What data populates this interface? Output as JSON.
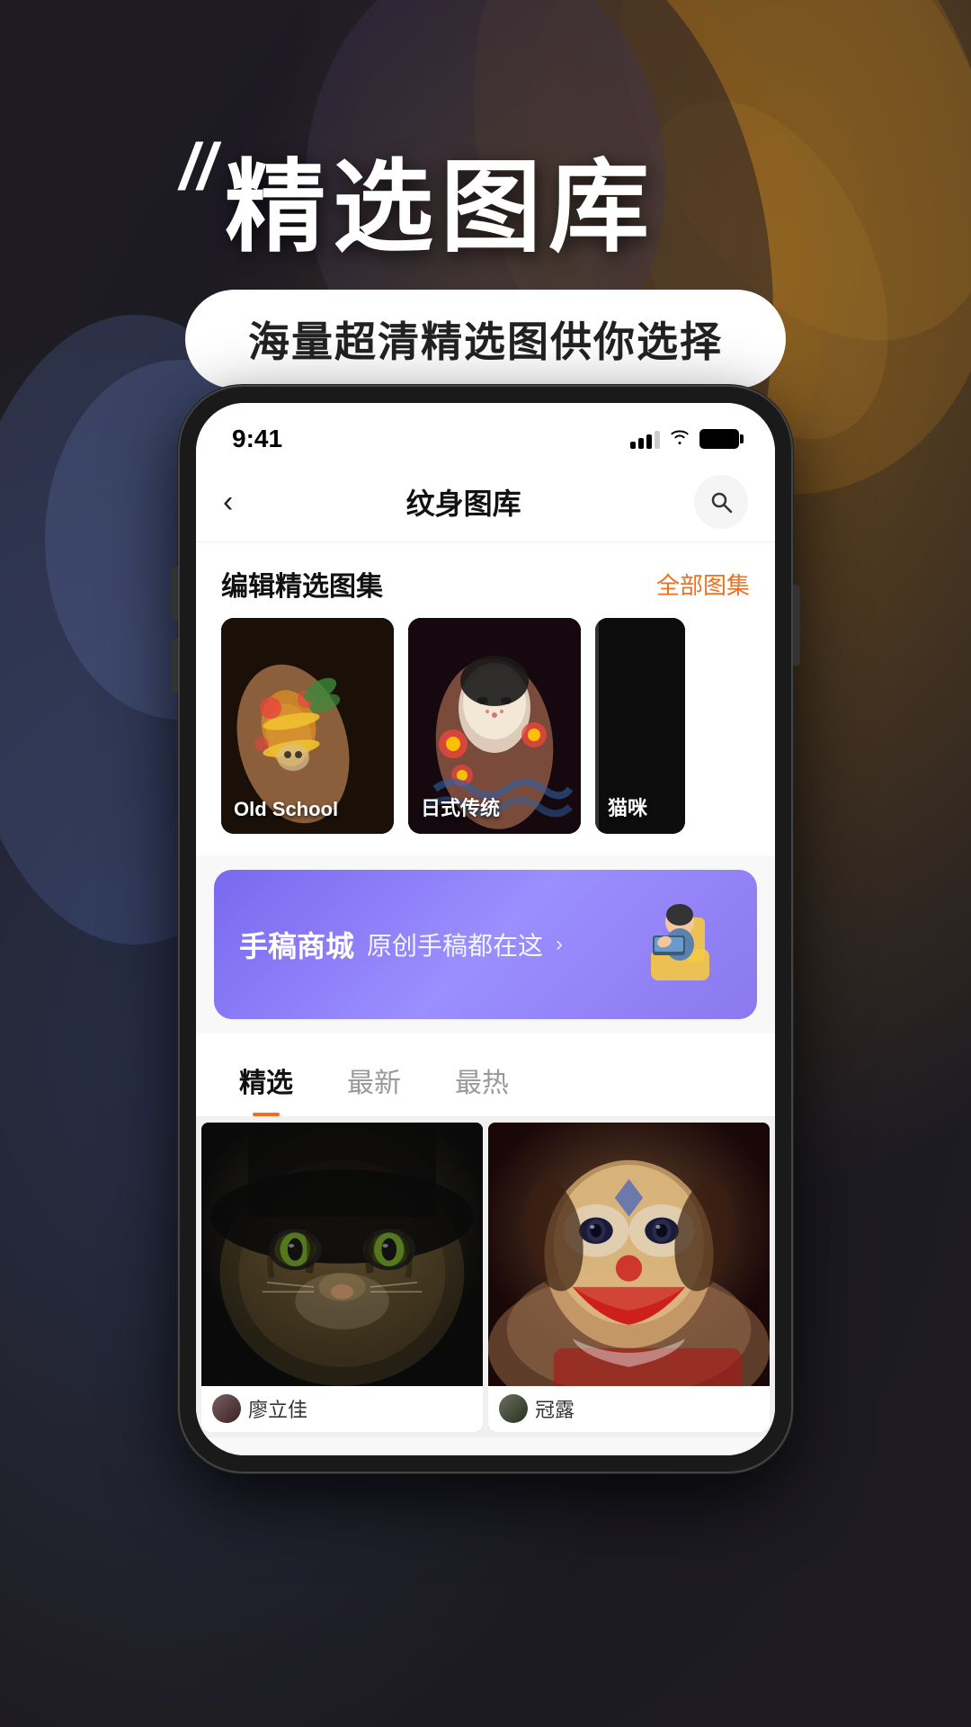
{
  "background": {
    "overlay_color": "#1e1c22"
  },
  "hero": {
    "quote_marks": "〃",
    "title": "精选图库",
    "subtitle": "海量超清精选图供你选择"
  },
  "phone": {
    "status_bar": {
      "time": "9:41",
      "signal_level": 3,
      "wifi": true,
      "battery": "full"
    },
    "nav": {
      "back_icon": "‹",
      "title": "纹身图库",
      "search_icon": "search"
    },
    "editor_picks": {
      "section_label": "编辑精选图集",
      "view_all_label": "全部图集",
      "cards": [
        {
          "label": "Old School",
          "style": "old-school"
        },
        {
          "label": "日式传统",
          "style": "japanese"
        },
        {
          "label": "猫咪",
          "style": "cat"
        }
      ]
    },
    "banner": {
      "title": "手稿商城",
      "subtitle": "原创手稿都在这",
      "arrow": "›",
      "bg_color": "#8b78ee"
    },
    "tabs": [
      {
        "label": "精选",
        "active": true
      },
      {
        "label": "最新",
        "active": false
      },
      {
        "label": "最热",
        "active": false
      }
    ],
    "gallery": [
      {
        "style": "tiger",
        "author_avatar_color": "#555",
        "author_name": "廖立佳"
      },
      {
        "style": "joker",
        "author_avatar_color": "#666",
        "author_name": "冠露"
      }
    ]
  }
}
